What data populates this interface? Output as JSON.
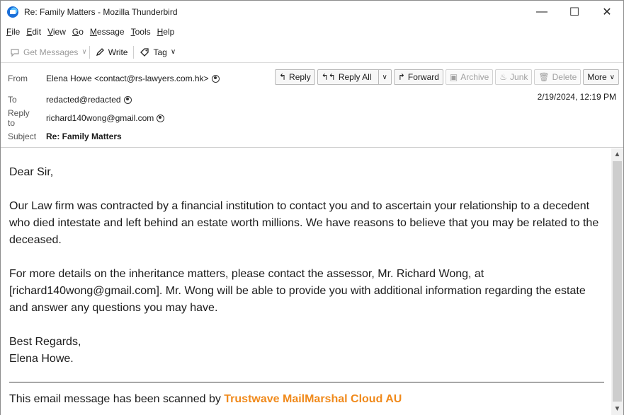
{
  "window": {
    "title": "Re: Family Matters - Mozilla Thunderbird",
    "controls": {
      "minimize": "—",
      "maximize": "☐",
      "close": "✕"
    }
  },
  "menu": [
    "File",
    "Edit",
    "View",
    "Go",
    "Message",
    "Tools",
    "Help"
  ],
  "menu_underline": [
    "F",
    "E",
    "V",
    "G",
    "M",
    "T",
    "H"
  ],
  "toolbar": {
    "get_messages": "Get Messages",
    "write": "Write",
    "tag": "Tag"
  },
  "header": {
    "from_label": "From",
    "from_value": "Elena Howe <contact@rs-lawyers.com.hk>",
    "to_label": "To",
    "to_value": "redacted@redacted",
    "reply_to_label": "Reply to",
    "reply_to_value": "richard140wong@gmail.com",
    "subject_label": "Subject",
    "subject_value": "Re: Family Matters",
    "date": "2/19/2024, 12:19 PM",
    "actions": {
      "reply": "Reply",
      "reply_all": "Reply All",
      "forward": "Forward",
      "archive": "Archive",
      "junk": "Junk",
      "delete": "Delete",
      "more": "More"
    }
  },
  "body": {
    "greeting": "Dear Sir,",
    "para1": "Our Law firm was contracted by a financial institution to contact you and to ascertain your relationship to a decedent who died intestate and left behind an estate worth millions. We have reasons to believe that you may be related to the deceased.",
    "para2": "For more details on the inheritance matters, please contact the assessor, Mr. Richard Wong, at [richard140wong@gmail.com]. Mr. Wong will be able to provide you with additional information regarding the estate and answer any questions you may have.",
    "closing": "Best Regards,",
    "signature": "Elena Howe.",
    "footer_text": "This email message has been scanned by ",
    "footer_brand": "Trustwave MailMarshal Cloud AU"
  },
  "colors": {
    "brand": "#f08a1c",
    "disabled": "#9a9a9a"
  }
}
